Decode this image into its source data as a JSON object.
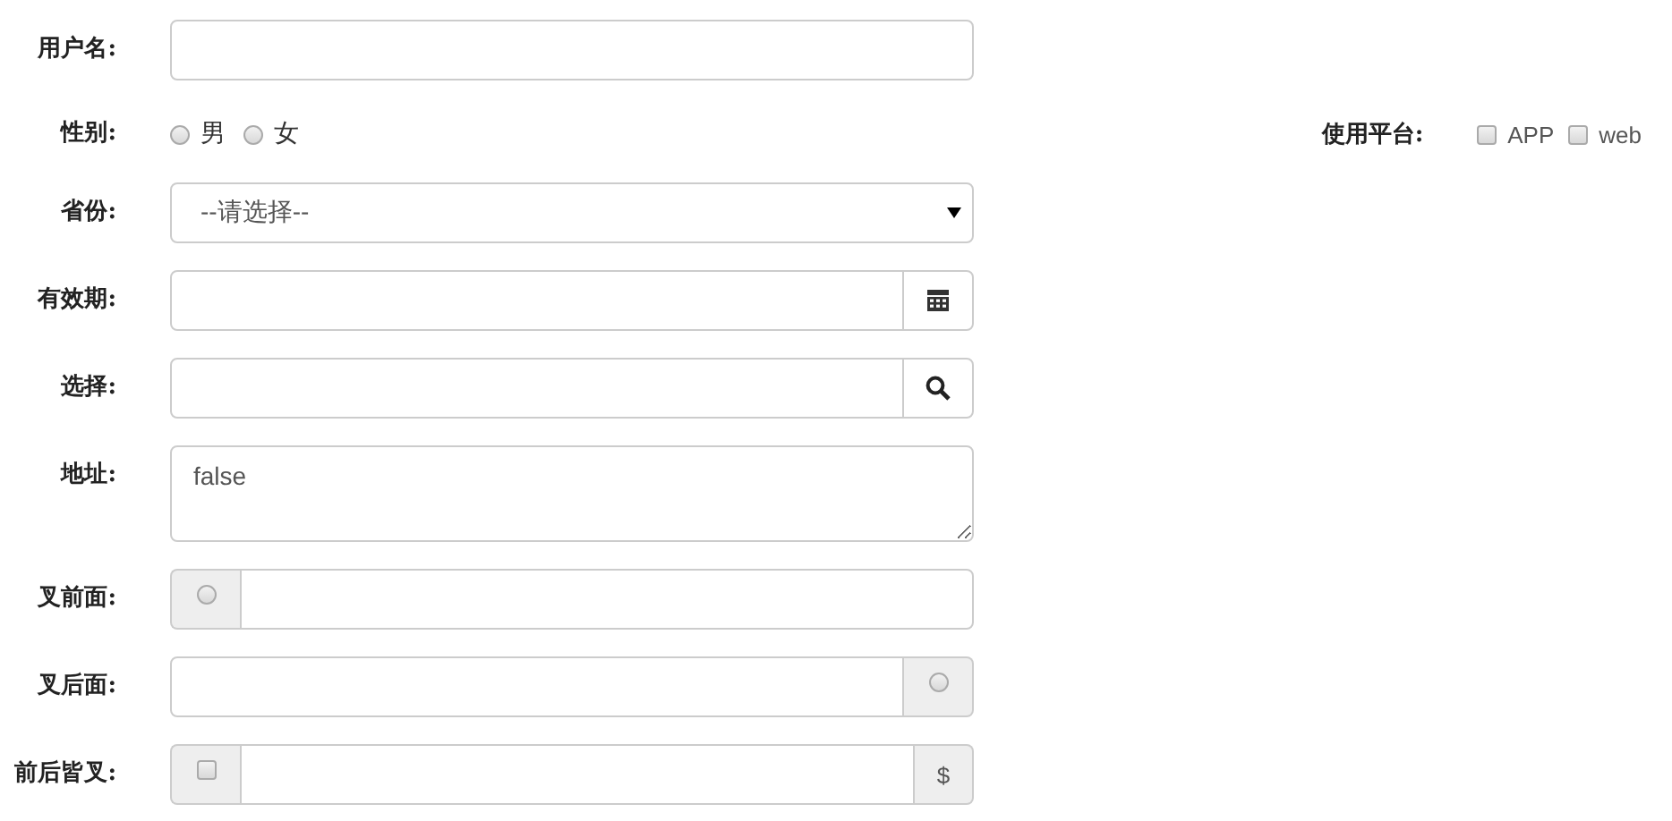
{
  "rows": [
    {
      "label": "用户名:",
      "kind": "text"
    },
    {
      "label": "性别:",
      "kind": "radios",
      "options": [
        {
          "label": "男",
          "selected": false
        },
        {
          "label": "女",
          "selected": false
        }
      ],
      "aside": {
        "label": "使用平台:",
        "options": [
          {
            "label": "APP",
            "checked": false
          },
          {
            "label": "web",
            "checked": false
          }
        ]
      }
    },
    {
      "label": "省份:",
      "kind": "select",
      "value": "--请选择--"
    },
    {
      "label": "有效期:",
      "kind": "text",
      "after": {
        "kind": "calendar"
      }
    },
    {
      "label": "选择:",
      "kind": "text",
      "after": {
        "kind": "search"
      }
    },
    {
      "label": "地址:",
      "kind": "textarea",
      "value": "false"
    },
    {
      "label": "叉前面:",
      "kind": "text",
      "before": {
        "kind": "radio",
        "selected": false
      }
    },
    {
      "label": "叉后面:",
      "kind": "text",
      "after": {
        "kind": "radio",
        "selected": false
      }
    },
    {
      "label": "前后皆叉:",
      "kind": "text",
      "before": {
        "kind": "checkbox",
        "checked": false
      },
      "after": {
        "kind": "text",
        "text": "$"
      }
    }
  ]
}
